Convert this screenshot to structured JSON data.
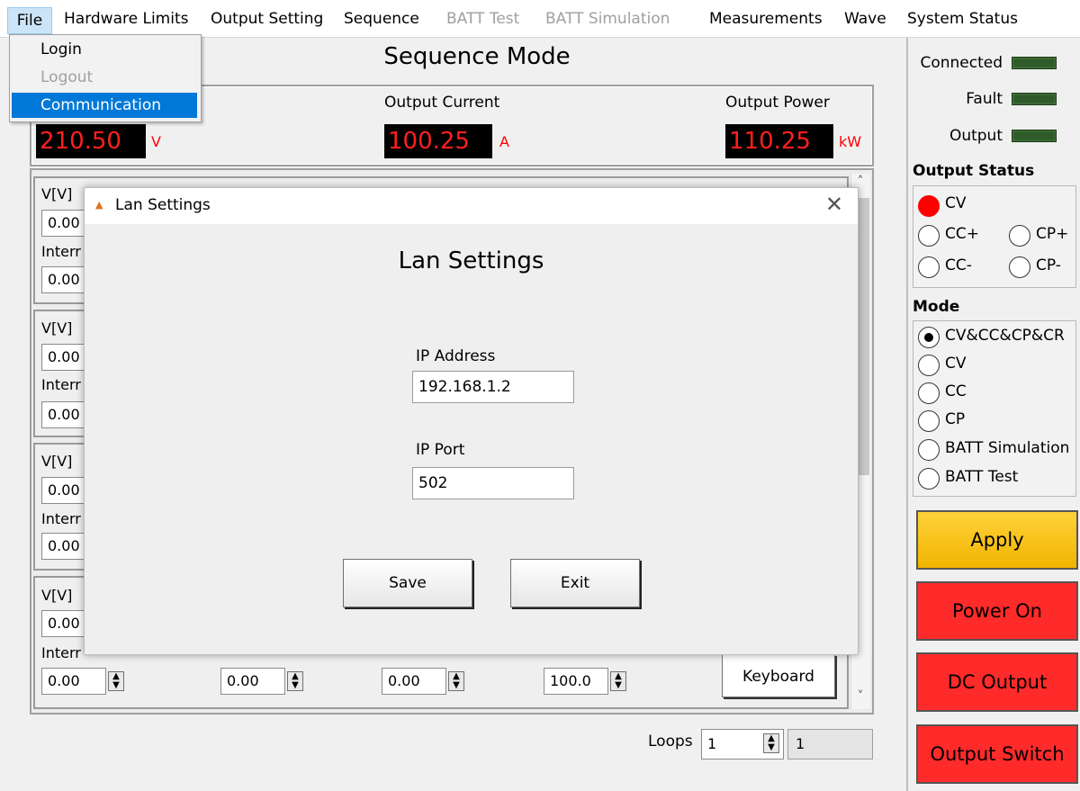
{
  "menu": {
    "items": [
      "File",
      "Hardware Limits",
      "Output Setting",
      "Sequence",
      "BATT Test",
      "BATT Simulation",
      "Measurements",
      "Wave",
      "System Status"
    ]
  },
  "file_menu": {
    "items": [
      "Login",
      "Logout",
      "Communication"
    ]
  },
  "page": {
    "title": "Sequence Mode"
  },
  "readouts": {
    "voltage": {
      "value": "210.50",
      "unit": "V"
    },
    "current": {
      "label": "Output Current",
      "value": "100.25",
      "unit": "A"
    },
    "power": {
      "label": "Output Power",
      "value": "110.25",
      "unit": "kW"
    }
  },
  "sequence": {
    "v_label": "V[V]",
    "internal_label": "Interr",
    "internal_label_full": "Interr",
    "default_value": "0.00",
    "last_row": {
      "r": "0.00",
      "c": "0.00",
      "p": "0.00",
      "switch": "100.0"
    },
    "keyboard_label": "Keyboard"
  },
  "loops": {
    "label": "Loops",
    "value": "1",
    "readout": "1"
  },
  "status": {
    "connected": "Connected",
    "fault": "Fault",
    "output": "Output"
  },
  "output_status": {
    "title": "Output Status",
    "options": [
      "CV",
      "CC+",
      "CP+",
      "CC-",
      "CP-"
    ]
  },
  "mode": {
    "title": "Mode",
    "options": [
      "CV&CC&CP&CR",
      "CV",
      "CC",
      "CP",
      "BATT Simulation",
      "BATT Test"
    ],
    "selected": "CV&CC&CP&CR"
  },
  "buttons": {
    "apply": "Apply",
    "power_on": "Power On",
    "dc_output": "DC Output",
    "output_switch": "Output Switch"
  },
  "dialog": {
    "window_title": "Lan Settings",
    "heading": "Lan Settings",
    "ip_address_label": "IP Address",
    "ip_address_value": "192.168.1.2",
    "ip_port_label": "IP Port",
    "ip_port_value": "502",
    "save_label": "Save",
    "exit_label": "Exit"
  }
}
